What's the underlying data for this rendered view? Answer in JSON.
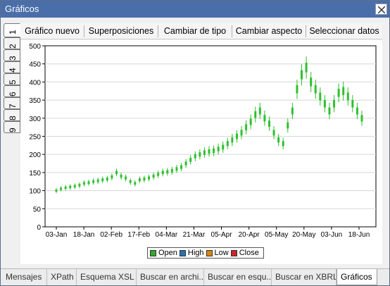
{
  "window": {
    "title": "Gráficos"
  },
  "toolbar": {
    "buttons": [
      "Gráfico nuevo",
      "Superposiciones",
      "Cambiar de tipo",
      "Cambiar aspecto",
      "Seleccionar datos"
    ]
  },
  "side_tabs": [
    "1",
    "2",
    "3",
    "4",
    "5",
    "6",
    "7",
    "8",
    "9"
  ],
  "bottom_tabs": [
    "Mensajes",
    "XPath",
    "Esquema XSL",
    "Buscar en archi...",
    "Buscar en esqu...",
    "Buscar en XBRL",
    "Gráficos"
  ],
  "active_bottom_tab": "Gráficos",
  "legend": {
    "items": [
      {
        "label": "Open",
        "color": "#2eaa2e"
      },
      {
        "label": "High",
        "color": "#2b6fb5"
      },
      {
        "label": "Low",
        "color": "#d9860f"
      },
      {
        "label": "Close",
        "color": "#d0202a"
      }
    ]
  },
  "chart_data": {
    "type": "line",
    "series_color": "#2fc02f",
    "ylim": [
      0,
      500
    ],
    "yticks": [
      "0",
      "50",
      "100",
      "150",
      "200",
      "250",
      "300",
      "350",
      "400",
      "450",
      "500"
    ],
    "xticks": [
      "03-Jan",
      "18-Jan",
      "02-Feb",
      "17-Feb",
      "04-Mar",
      "21-Mar",
      "05-Apr",
      "20-Apr",
      "05-May",
      "20-May",
      "03-Jun",
      "18-Jun"
    ],
    "grid": true,
    "legend_position": "bottom",
    "series": [
      {
        "name": "Open",
        "values": [
          100,
          105,
          108,
          110,
          112,
          115,
          120,
          122,
          125,
          127,
          130,
          132,
          138,
          150,
          140,
          135,
          125,
          120,
          130,
          132,
          135,
          140,
          145,
          150,
          152,
          155,
          160,
          165,
          175,
          185,
          195,
          200,
          205,
          208,
          210,
          215,
          220,
          230,
          240,
          250,
          260,
          275,
          290,
          310,
          320,
          300,
          285,
          260,
          240,
          230,
          280,
          320,
          380,
          420,
          440,
          400,
          380,
          360,
          340,
          320,
          340,
          370,
          375,
          360,
          340,
          320,
          300
        ]
      }
    ]
  }
}
